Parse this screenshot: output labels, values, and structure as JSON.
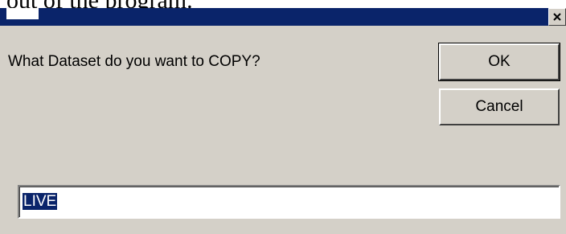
{
  "document": {
    "background_text": "out of the program."
  },
  "dialog": {
    "prompt": "What Dataset do you want to COPY?",
    "ok_label": "OK",
    "cancel_label": "Cancel",
    "input_value": "LIVE",
    "close_glyph": "×"
  },
  "colors": {
    "titlebar": "#0a246a",
    "dialog_bg": "#d4d0c8",
    "selection_bg": "#0a246a"
  },
  "icons": {
    "close": "close-icon"
  }
}
